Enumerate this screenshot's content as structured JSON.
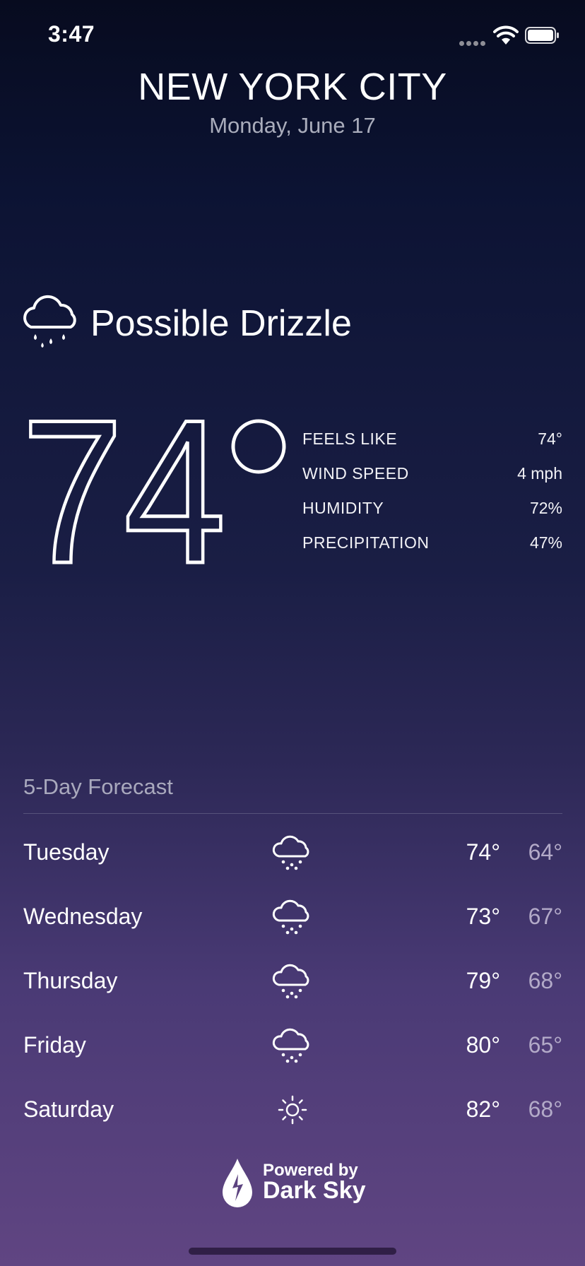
{
  "status_bar": {
    "time": "3:47"
  },
  "header": {
    "city": "NEW YORK CITY",
    "date": "Monday, June 17"
  },
  "current": {
    "condition": "Possible Drizzle",
    "condition_icon": "rain-cloud-icon",
    "temperature": "74",
    "degree": "°",
    "details": [
      {
        "label": "FEELS LIKE",
        "value": "74°"
      },
      {
        "label": "WIND SPEED",
        "value": "4 mph"
      },
      {
        "label": "HUMIDITY",
        "value": "72%"
      },
      {
        "label": "PRECIPITATION",
        "value": "47%"
      }
    ]
  },
  "forecast": {
    "title": "5-Day Forecast",
    "days": [
      {
        "day": "Tuesday",
        "icon": "rain-cloud-icon",
        "high": "74°",
        "low": "64°"
      },
      {
        "day": "Wednesday",
        "icon": "rain-cloud-icon",
        "high": "73°",
        "low": "67°"
      },
      {
        "day": "Thursday",
        "icon": "rain-cloud-icon",
        "high": "79°",
        "low": "68°"
      },
      {
        "day": "Friday",
        "icon": "rain-cloud-icon",
        "high": "80°",
        "low": "65°"
      },
      {
        "day": "Saturday",
        "icon": "sun-icon",
        "high": "82°",
        "low": "68°"
      }
    ]
  },
  "footer": {
    "powered_by": "Powered by",
    "brand": "Dark Sky",
    "logo_icon": "dark-sky-drop-icon"
  },
  "colors": {
    "text_primary": "#ffffff",
    "text_secondary": "#a9acbb",
    "low_temp": "#b3aac8"
  }
}
